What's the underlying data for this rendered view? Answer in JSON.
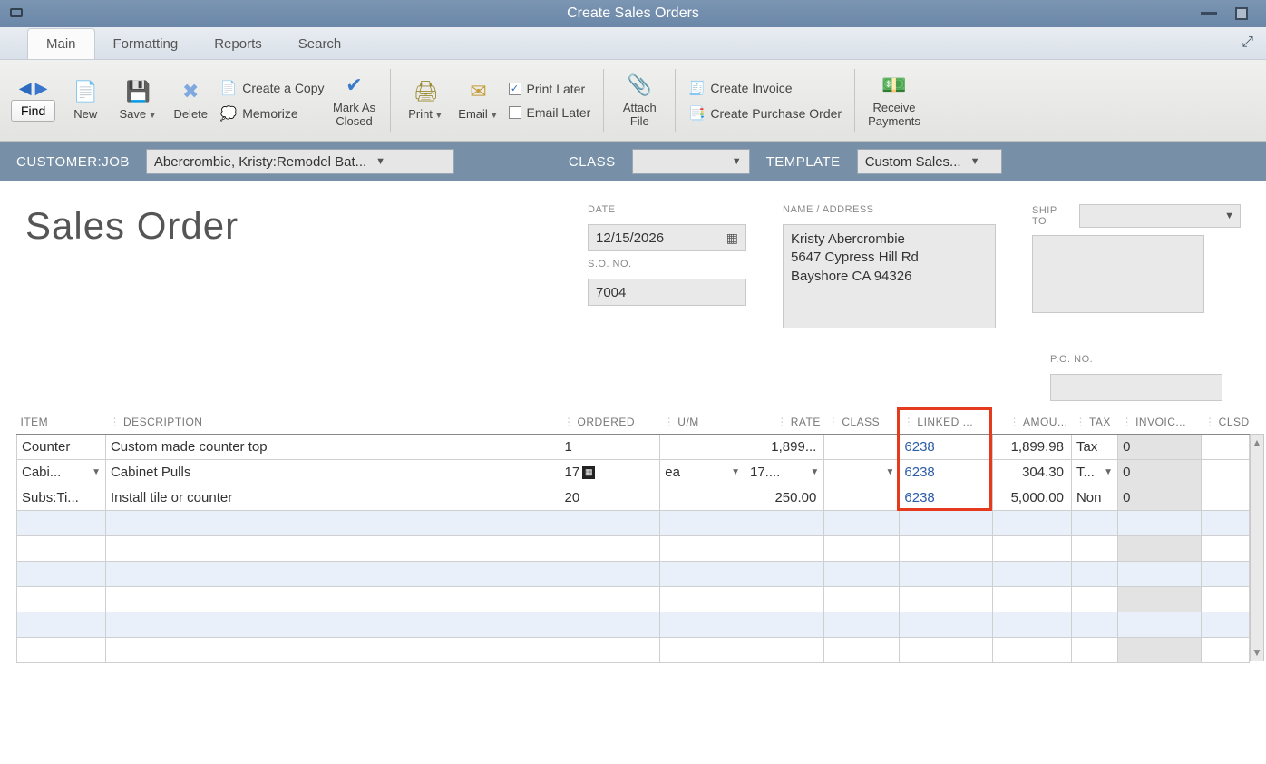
{
  "window": {
    "title": "Create Sales Orders"
  },
  "tabs": {
    "main": "Main",
    "formatting": "Formatting",
    "reports": "Reports",
    "search": "Search"
  },
  "ribbon": {
    "find": "Find",
    "new": "New",
    "save": "Save",
    "delete": "Delete",
    "create_copy": "Create a Copy",
    "memorize": "Memorize",
    "mark_closed": "Mark As\nClosed",
    "print": "Print",
    "email": "Email",
    "print_later": "Print Later",
    "email_later": "Email Later",
    "attach": "Attach\nFile",
    "create_invoice": "Create Invoice",
    "create_po": "Create Purchase Order",
    "receive": "Receive\nPayments",
    "print_later_checked": "✓"
  },
  "custbar": {
    "customer_label": "CUSTOMER:JOB",
    "customer_value": "Abercrombie, Kristy:Remodel Bat...",
    "class_label": "CLASS",
    "class_value": "",
    "template_label": "TEMPLATE",
    "template_value": "Custom Sales..."
  },
  "form": {
    "title": "Sales Order",
    "date_label": "DATE",
    "date_value": "12/15/2026",
    "sono_label": "S.O. NO.",
    "sono_value": "7004",
    "name_label": "NAME / ADDRESS",
    "address_line1": "Kristy Abercrombie",
    "address_line2": "5647 Cypress Hill Rd",
    "address_line3": "Bayshore CA 94326",
    "shipto_label": "SHIP TO",
    "pono_label": "P.O. NO."
  },
  "table": {
    "headers": {
      "item": "ITEM",
      "description": "DESCRIPTION",
      "ordered": "ORDERED",
      "um": "U/M",
      "rate": "RATE",
      "class": "CLASS",
      "linked": "LINKED ...",
      "amount": "AMOU...",
      "tax": "TAX",
      "invoiced": "INVOIC...",
      "clsd": "CLSD"
    },
    "rows": [
      {
        "item": "Counter",
        "desc": "Custom made counter top",
        "ordered": "1",
        "um": "",
        "rate": "1,899...",
        "class": "",
        "linked": "6238",
        "amount": "1,899.98",
        "tax": "Tax",
        "invoiced": "0",
        "clsd": ""
      },
      {
        "item": "Cabi...",
        "desc": "Cabinet Pulls",
        "ordered": "17",
        "um": "ea",
        "rate": "17....",
        "class": "",
        "linked": "6238",
        "amount": "304.30",
        "tax": "T...",
        "invoiced": "0",
        "clsd": ""
      },
      {
        "item": "Subs:Ti...",
        "desc": "Install tile or counter",
        "ordered": "20",
        "um": "",
        "rate": "250.00",
        "class": "",
        "linked": "6238",
        "amount": "5,000.00",
        "tax": "Non",
        "invoiced": "0",
        "clsd": ""
      }
    ]
  }
}
